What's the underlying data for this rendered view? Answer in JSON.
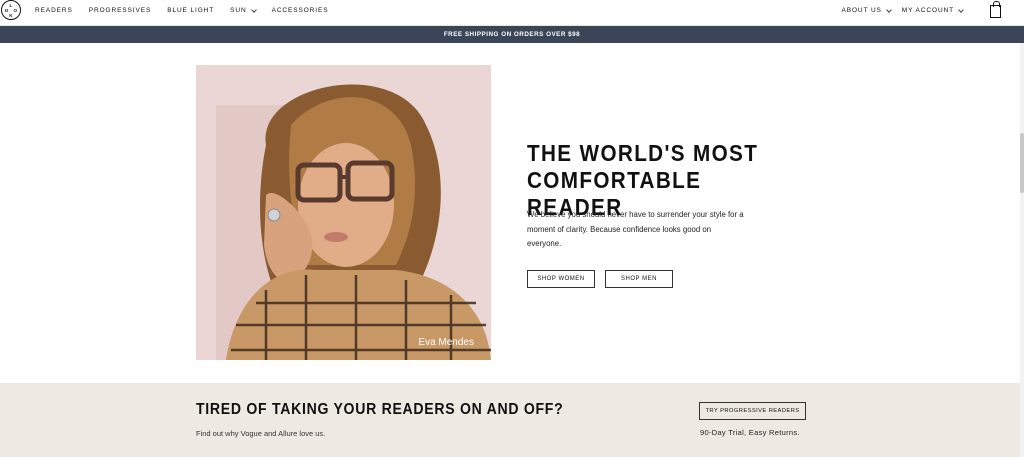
{
  "logo": {
    "letters": [
      "L",
      "O",
      "O",
      "K"
    ]
  },
  "nav": {
    "left": [
      {
        "label": "READERS",
        "has_dropdown": false
      },
      {
        "label": "PROGRESSIVES",
        "has_dropdown": false
      },
      {
        "label": "BLUE LIGHT",
        "has_dropdown": false
      },
      {
        "label": "SUN",
        "has_dropdown": true
      },
      {
        "label": "ACCESSORIES",
        "has_dropdown": false
      }
    ],
    "right": [
      {
        "label": "ABOUT US",
        "has_dropdown": true
      },
      {
        "label": "MY ACCOUNT",
        "has_dropdown": true
      }
    ],
    "cart_icon": "shopping-bag-icon"
  },
  "banner": {
    "text": "FREE SHIPPING ON ORDERS OVER $98",
    "color": "#3a4657"
  },
  "hero": {
    "photo_caption": "Eva Mendes",
    "title_line1": "THE WORLD'S MOST",
    "title_line2": "COMFORTABLE READER",
    "body": "We believe you should never have to surrender your style for a moment of clarity. Because confidence looks good on everyone.",
    "button_women": "SHOP WOMEN",
    "button_men": "SHOP MEN"
  },
  "band": {
    "title": "TIRED OF TAKING YOUR READERS ON AND OFF?",
    "subtitle": "Find out why Vogue and Allure love us.",
    "button": "TRY PROGRESSIVE READERS",
    "note": "90-Day Trial, Easy Returns.",
    "background": "#efe9e4"
  }
}
